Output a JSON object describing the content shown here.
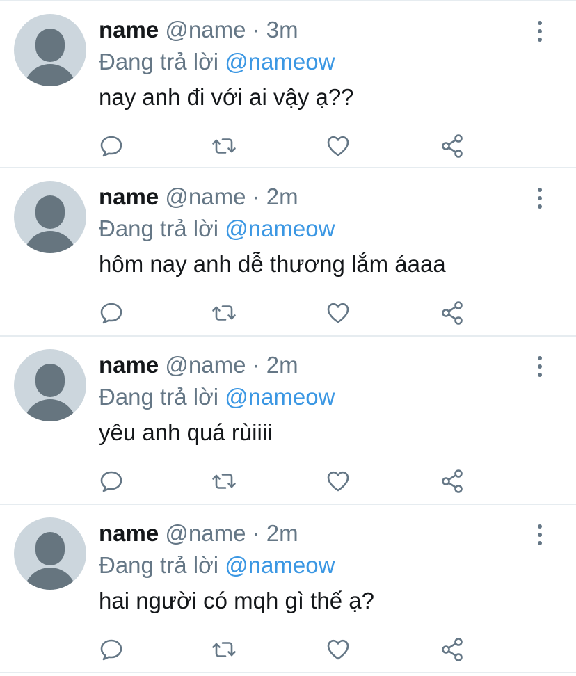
{
  "tweets": [
    {
      "name": "name",
      "handle": "@name",
      "separator": "·",
      "time": "3m",
      "reply_prefix": "Đang trả lời",
      "reply_to": "@nameow",
      "text": "nay anh đi với ai vậy ạ??"
    },
    {
      "name": "name",
      "handle": "@name",
      "separator": "·",
      "time": "2m",
      "reply_prefix": "Đang trả lời",
      "reply_to": "@nameow",
      "text": "hôm nay anh dễ thương lắm áaaa"
    },
    {
      "name": "name",
      "handle": "@name",
      "separator": "·",
      "time": "2m",
      "reply_prefix": "Đang trả lời",
      "reply_to": "@nameow",
      "text": "yêu anh quá rùiiii"
    },
    {
      "name": "name",
      "handle": "@name",
      "separator": "·",
      "time": "2m",
      "reply_prefix": "Đang trả lời",
      "reply_to": "@nameow",
      "text": "hai người có mqh gì thế ạ?"
    }
  ],
  "icons": {
    "reply": "comment-icon",
    "retweet": "retweet-icon",
    "like": "heart-icon",
    "share": "share-icon",
    "more": "more-vertical-icon",
    "avatar": "default-avatar-icon"
  },
  "colors": {
    "text": "#14171a",
    "secondary": "#657786",
    "mention": "#3b97e3",
    "divider": "#e6ecf0",
    "avatar_bg": "#ccd6dd"
  }
}
